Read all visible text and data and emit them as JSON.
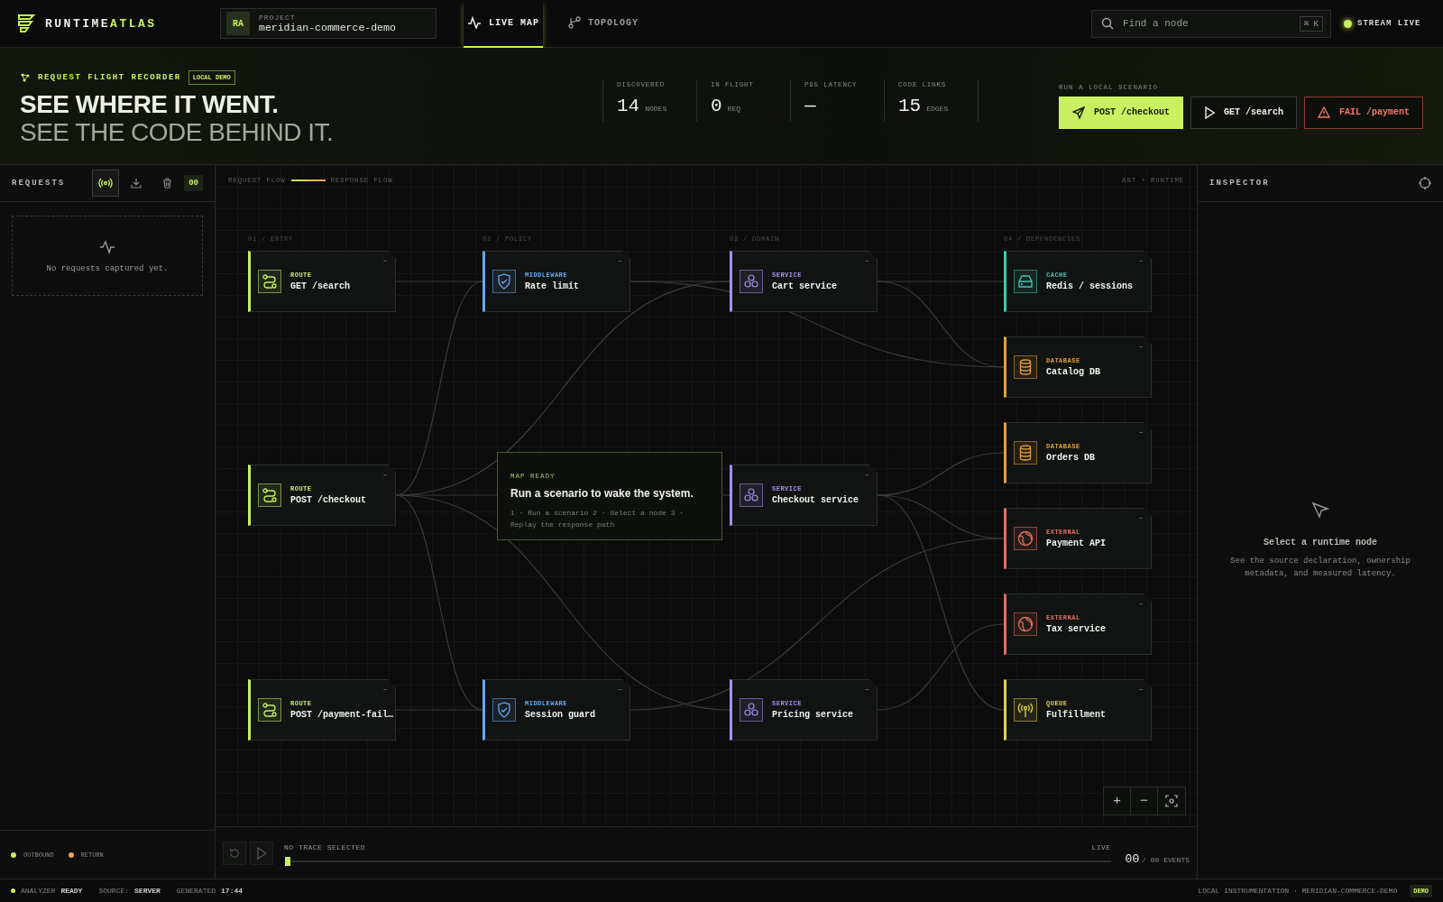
{
  "brand": {
    "first": "RUNTIME",
    "second": "ATLAS"
  },
  "project": {
    "initials": "RA",
    "label": "PROJECT",
    "name": "meridian-commerce-demo"
  },
  "nav": {
    "tabs": [
      {
        "label": "LIVE MAP",
        "selected": true
      },
      {
        "label": "TOPOLOGY",
        "selected": false
      }
    ]
  },
  "search": {
    "placeholder": "Find a node",
    "shortcut": "⌘ K"
  },
  "stream": {
    "label": "STREAM LIVE",
    "on": true
  },
  "hero": {
    "eyebrow": "REQUEST FLIGHT RECORDER",
    "badge": "LOCAL DEMO",
    "title": "SEE WHERE IT WENT.",
    "subtitle": "SEE THE CODE BEHIND IT."
  },
  "stats": [
    {
      "label": "DISCOVERED",
      "value": "14",
      "unit": "NODES"
    },
    {
      "label": "IN FLIGHT",
      "value": "0",
      "unit": "REQ"
    },
    {
      "label": "P95 LATENCY",
      "value": "—"
    },
    {
      "label": "CODE LINKS",
      "value": "15",
      "unit": "EDGES"
    }
  ],
  "scenarios": {
    "label": "RUN A LOCAL SCENARIO",
    "buttons": [
      {
        "kind": "primary",
        "label": "POST /checkout"
      },
      {
        "kind": "ghost",
        "label": "GET /search"
      },
      {
        "kind": "danger",
        "label": "FAIL /payment"
      }
    ]
  },
  "requests": {
    "title": "REQUESTS",
    "capture_on": true,
    "count": "00",
    "empty": "No requests captured yet.",
    "legend": [
      {
        "label": "OUTBOUND",
        "color": "#c8f060"
      },
      {
        "label": "RETURN",
        "color": "#f0a050"
      }
    ]
  },
  "canvas": {
    "legend_request": "REQUEST FLOW",
    "legend_response": "RESPONSE FLOW",
    "mode": "AST + RUNTIME",
    "columns": [
      {
        "label": "01 / ENTRY",
        "nodes": [
          {
            "kind": "route",
            "type": "ROUTE",
            "name": "GET /search",
            "metric": "–"
          },
          {
            "kind": "route",
            "type": "ROUTE",
            "name": "POST /checkout",
            "metric": "–"
          },
          {
            "kind": "route",
            "type": "ROUTE",
            "name": "POST /payment-fail…",
            "metric": "–"
          }
        ]
      },
      {
        "label": "02 / POLICY",
        "nodes": [
          {
            "kind": "middleware",
            "type": "MIDDLEWARE",
            "name": "Rate limit",
            "metric": "–"
          },
          {
            "kind": "middleware",
            "type": "MIDDLEWARE",
            "name": "Session guard",
            "metric": "–"
          }
        ]
      },
      {
        "label": "03 / DOMAIN",
        "nodes": [
          {
            "kind": "service",
            "type": "SERVICE",
            "name": "Cart service",
            "metric": "–"
          },
          {
            "kind": "service",
            "type": "SERVICE",
            "name": "Checkout service",
            "metric": "–"
          },
          {
            "kind": "service",
            "type": "SERVICE",
            "name": "Pricing service",
            "metric": "–"
          }
        ]
      },
      {
        "label": "04 / DEPENDENCIES",
        "nodes": [
          {
            "kind": "cache",
            "type": "CACHE",
            "name": "Redis / sessions",
            "metric": "–"
          },
          {
            "kind": "database",
            "type": "DATABASE",
            "name": "Catalog DB",
            "metric": "–"
          },
          {
            "kind": "database",
            "type": "DATABASE",
            "name": "Orders DB",
            "metric": "–"
          },
          {
            "kind": "external",
            "type": "EXTERNAL",
            "name": "Payment API",
            "metric": "–"
          },
          {
            "kind": "external",
            "type": "EXTERNAL",
            "name": "Tax service",
            "metric": "–"
          },
          {
            "kind": "queue",
            "type": "QUEUE",
            "name": "Fulfillment",
            "metric": "–"
          }
        ]
      }
    ],
    "notice": {
      "eyebrow": "MAP READY",
      "title": "Run a scenario to wake the system.",
      "steps": "1 · Run a scenario 2 · Select a node 3 · Replay the response path"
    },
    "zoom": [
      "+",
      "−"
    ]
  },
  "timeline": {
    "disabled": true,
    "status": "NO TRACE SELECTED",
    "live": "LIVE",
    "level": 0,
    "count": "00",
    "total": "/ 00 EVENTS"
  },
  "inspector": {
    "title": "INSPECTOR",
    "empty_title": "Select a runtime node",
    "empty_text": "See the source declaration, ownership metadata, and measured latency."
  },
  "status_bar": {
    "analyzer": "ANALYZER",
    "analyzer_state": "READY",
    "source_label": "SOURCE:",
    "source": "SERVER",
    "generated_label": "GENERATED",
    "generated": "17:44",
    "right": "LOCAL INSTRUMENTATION · MERIDIAN-COMMERCE-DEMO",
    "badge": "DEMO"
  }
}
